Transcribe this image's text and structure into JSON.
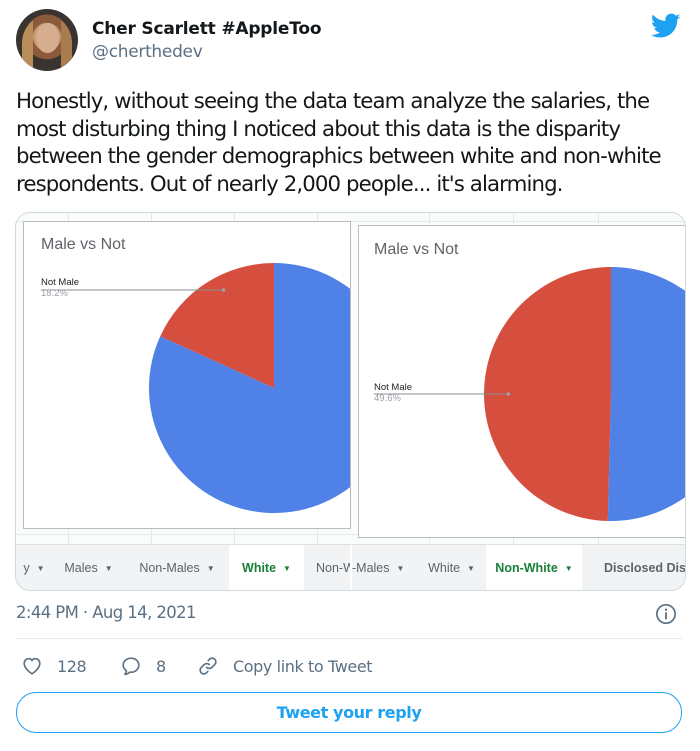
{
  "author": {
    "display_name": "Cher Scarlett #AppleToo",
    "handle": "@cherthedev"
  },
  "tweet": {
    "text": "Honestly, without seeing the data team analyze the salaries, the most disturbing thing I noticed about this data is  the disparity between the gender demographics between white and non-white respondents. Out of nearly 2,000 people... it's alarming.",
    "timestamp": "2:44 PM · Aug 14, 2021"
  },
  "actions": {
    "likes": "128",
    "replies": "8",
    "copy_link_label": "Copy link to Tweet"
  },
  "reply_button_label": "Tweet your reply",
  "colors": {
    "twitter_blue": "#1da1f2",
    "pie_male": "#4f81e6",
    "pie_not_male": "#d64f3e",
    "active_tab": "#188038"
  },
  "media": {
    "left_sheet_tabs": [
      {
        "label": "y",
        "active": false
      },
      {
        "label": "Males",
        "active": false
      },
      {
        "label": "Non-Males",
        "active": false
      },
      {
        "label": "White",
        "active": true
      },
      {
        "label": "Non-W",
        "active": false
      }
    ],
    "right_sheet_tabs": [
      {
        "label": "-Males",
        "active": false
      },
      {
        "label": "White",
        "active": false
      },
      {
        "label": "Non-White",
        "active": true
      },
      {
        "label": "Disclosed Dis",
        "active": false
      }
    ]
  },
  "chart_data": [
    {
      "type": "pie",
      "title": "Male vs Not",
      "context_tab": "White",
      "slices": [
        {
          "label": "Not Male",
          "value": 18.2,
          "color": "#d64f3e",
          "label_text": "Not Male",
          "pct_text": "18.2%"
        },
        {
          "label": "Male",
          "value": 81.8,
          "color": "#4f81e6"
        }
      ]
    },
    {
      "type": "pie",
      "title": "Male vs Not",
      "context_tab": "Non-White",
      "slices": [
        {
          "label": "Not Male",
          "value": 49.6,
          "color": "#d64f3e",
          "label_text": "Not Male",
          "pct_text": "49.6%"
        },
        {
          "label": "Male",
          "value": 50.4,
          "color": "#4f81e6"
        }
      ]
    }
  ]
}
